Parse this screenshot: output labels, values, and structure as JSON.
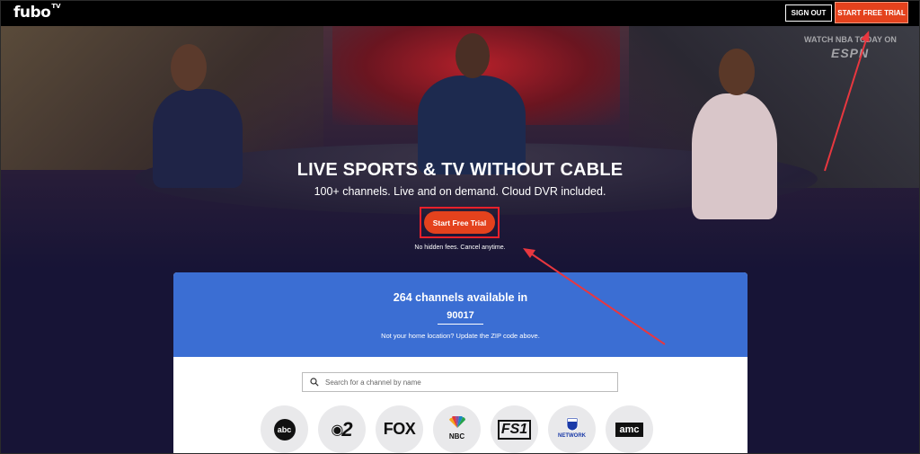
{
  "header": {
    "logo_text": "fubo",
    "logo_suffix": "TV",
    "sign_out_label": "SIGN OUT",
    "start_trial_label": "START FREE TRIAL"
  },
  "hero": {
    "watermark_line1": "WATCH NBA TODAY ON",
    "watermark_line2": "ESPN",
    "title": "LIVE SPORTS & TV WITHOUT CABLE",
    "subtitle": "100+ channels. Live and on demand. Cloud DVR included.",
    "cta_label": "Start Free Trial",
    "cta_note": "No hidden fees. Cancel anytime."
  },
  "channels_card": {
    "count_text": "264 channels available in",
    "zip_code": "90017",
    "zip_note": "Not your home location? Update the ZIP code above.",
    "search_placeholder": "Search for a channel by name",
    "logos": [
      {
        "name": "abc",
        "label": "abc"
      },
      {
        "name": "cbs",
        "label": "2"
      },
      {
        "name": "fox",
        "label": "FOX"
      },
      {
        "name": "nbc",
        "label": "NBC"
      },
      {
        "name": "fs1",
        "label": "FS1"
      },
      {
        "name": "nfl-network",
        "label": "NETWORK"
      },
      {
        "name": "amc",
        "label": "amc"
      }
    ]
  },
  "colors": {
    "accent_orange": "#e4421d",
    "card_blue": "#3b6ed3",
    "page_bg": "#171436",
    "annotation_red": "#e8202b"
  }
}
